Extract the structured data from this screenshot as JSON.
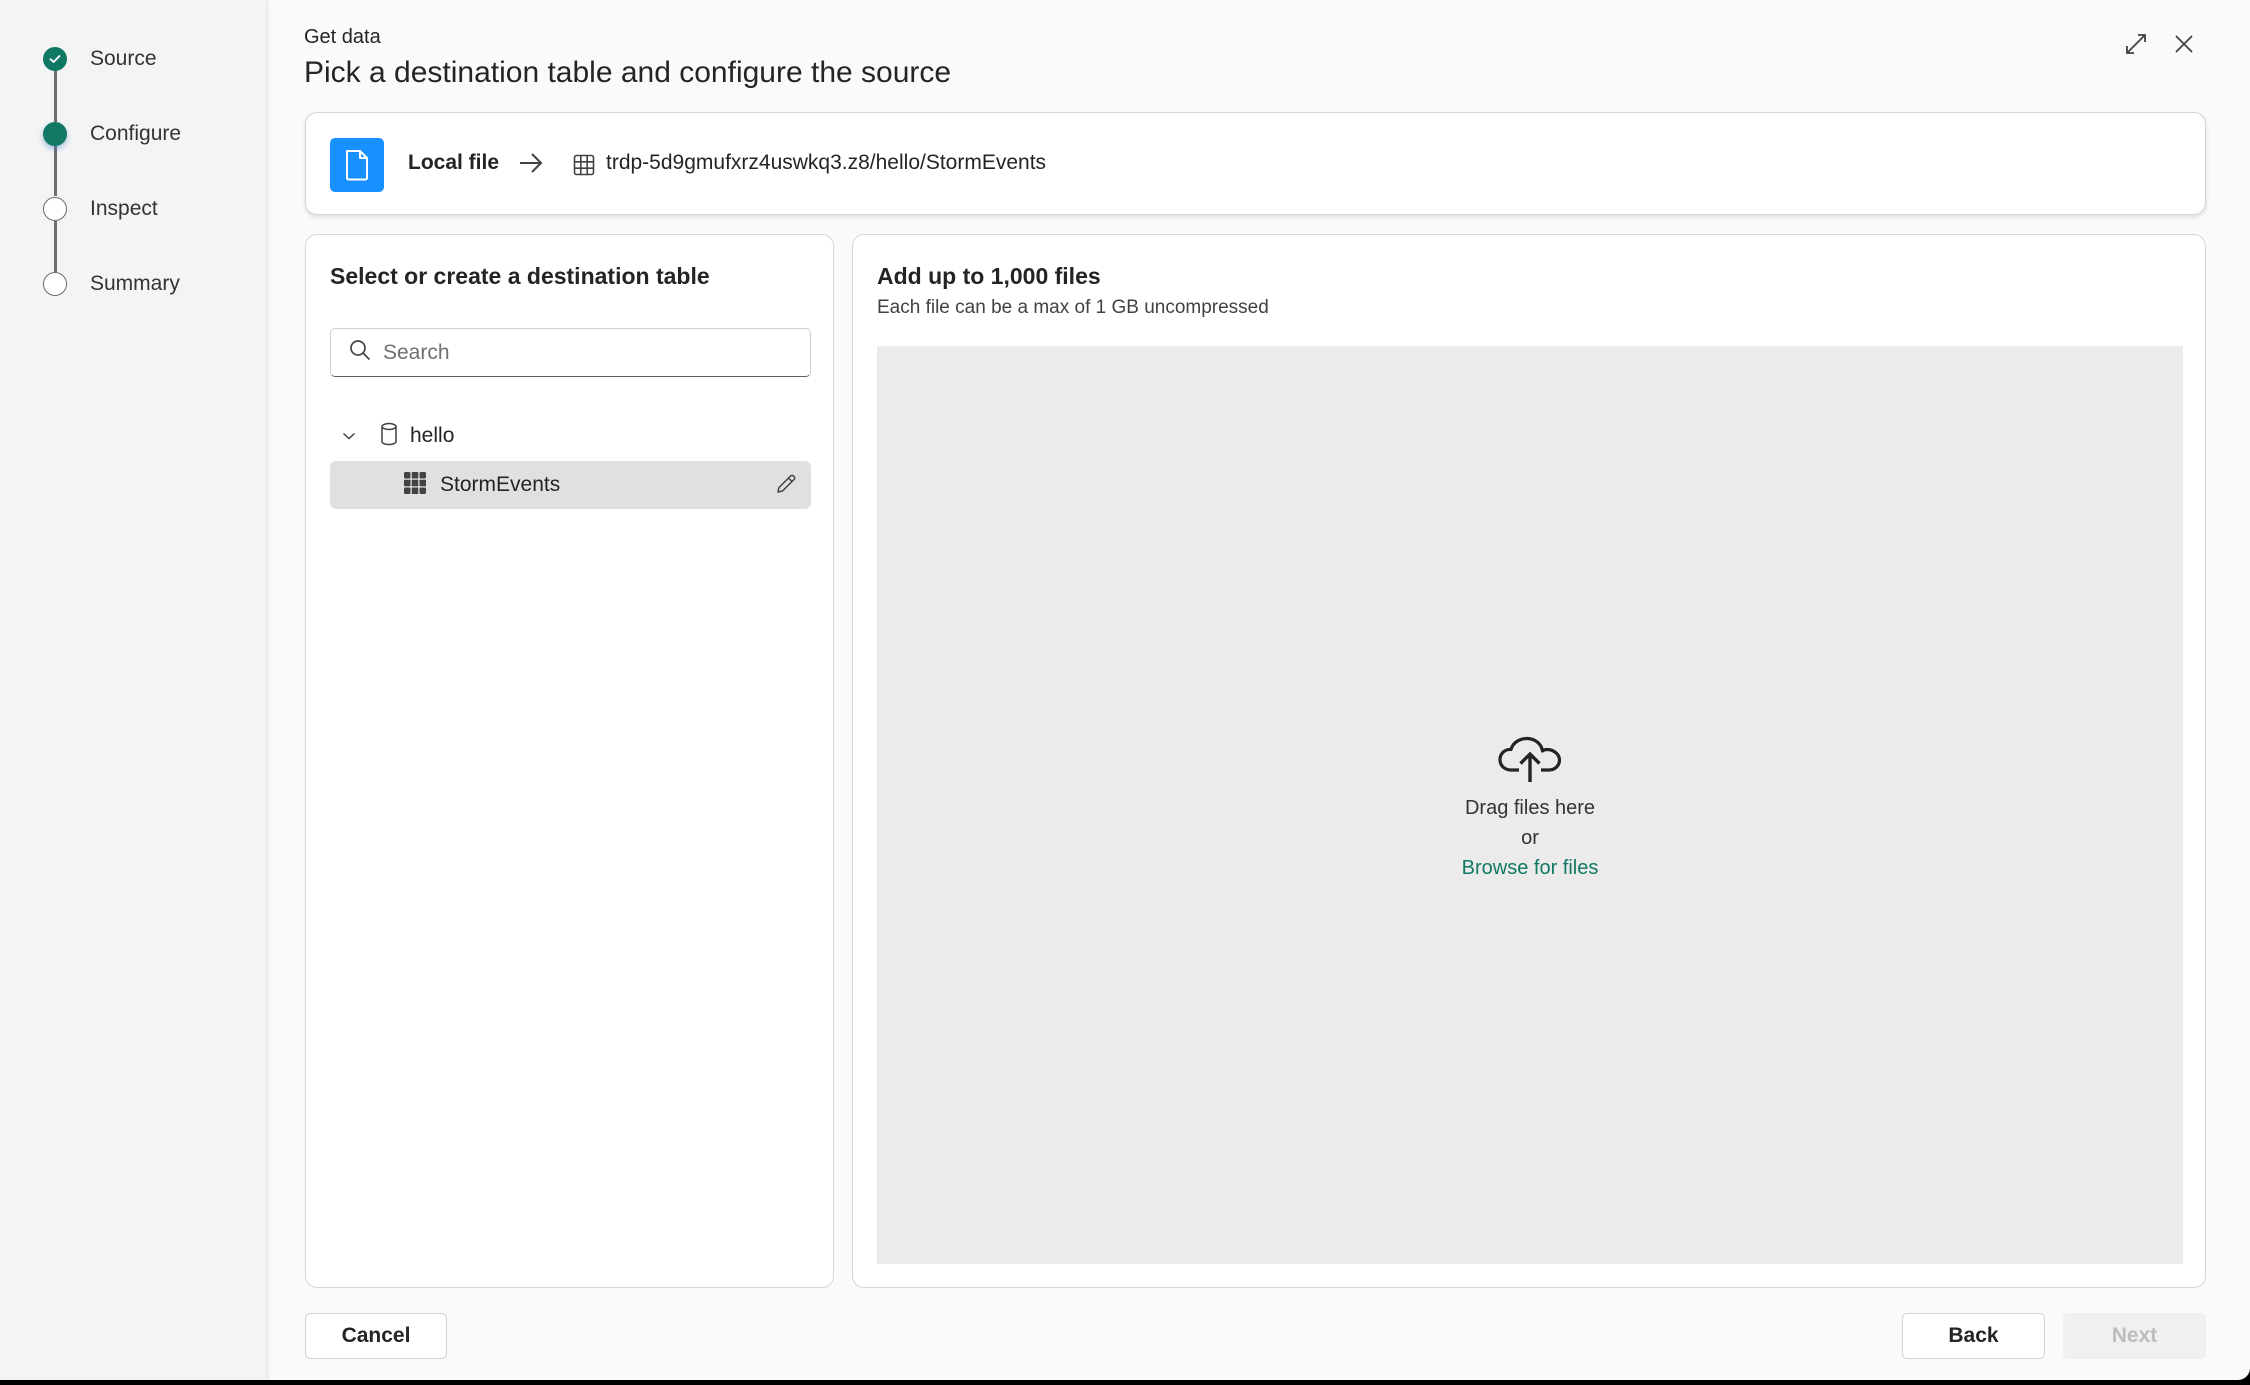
{
  "wizard": {
    "steps": [
      {
        "label": "Source",
        "state": "done"
      },
      {
        "label": "Configure",
        "state": "current"
      },
      {
        "label": "Inspect",
        "state": "pending"
      },
      {
        "label": "Summary",
        "state": "pending"
      }
    ]
  },
  "header": {
    "subtitle": "Get data",
    "title": "Pick a destination table and configure the source",
    "expand_icon": "expand-icon",
    "close_icon": "close-icon"
  },
  "source_card": {
    "source_icon": "file-icon",
    "source_label": "Local file",
    "arrow_icon": "arrow-right-icon",
    "dest_icon": "table-icon",
    "dest_path": "trdp-5d9gmufxrz4uswkq3.z8/hello/StormEvents",
    "accent_color": "#1890ff"
  },
  "destination_panel": {
    "title": "Select or create a destination table",
    "search": {
      "placeholder": "Search",
      "value": ""
    },
    "tree": {
      "database": {
        "name": "hello",
        "expanded": true
      },
      "tables": [
        {
          "name": "StormEvents",
          "selected": true
        }
      ]
    }
  },
  "upload_panel": {
    "title": "Add up to 1,000 files",
    "subtitle": "Each file can be a max of 1 GB uncompressed",
    "drop_text": "Drag files here",
    "or_text": "or",
    "browse_link": "Browse for files",
    "link_color": "#117865"
  },
  "footer": {
    "cancel_label": "Cancel",
    "back_label": "Back",
    "next_label": "Next",
    "next_disabled": true
  },
  "theme": {
    "step_color": "#117865"
  }
}
